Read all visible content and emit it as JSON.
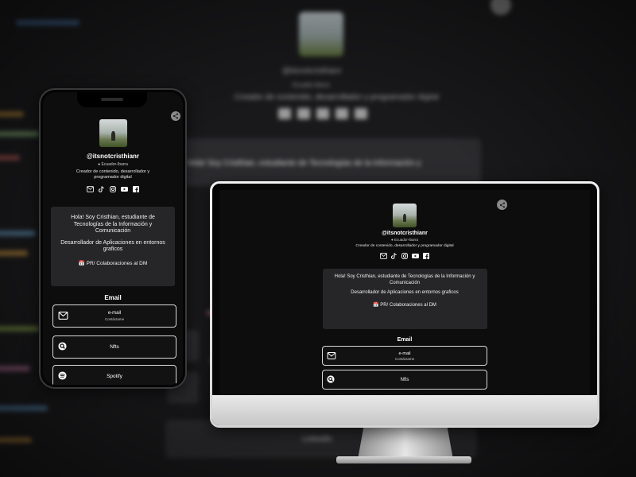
{
  "profile": {
    "handle": "@itsnotcristhianr",
    "location": "Ecuador-Ibarra",
    "bio": "Creador de contenido, desarrollador y programador digital",
    "intro_greeting": "Hola! Soy Cristhian, estudiante de Tecnologías de la Información y Comunicación",
    "intro_dev": "Desarrollador de Aplicaciones en entornos graficos",
    "intro_collab": "PR/ Colaboraciones al DM",
    "collab_emoji": "📅",
    "social_icons": [
      "email-icon",
      "tiktok-icon",
      "instagram-icon",
      "youtube-icon",
      "facebook-icon"
    ]
  },
  "sections": {
    "email_title": "Email"
  },
  "links": {
    "email": {
      "label": "e-mail",
      "sublabel": "Contáctame",
      "icon": "mail-icon"
    },
    "nfts": {
      "label": "Nfts",
      "icon": "opensea-icon"
    },
    "spotify": {
      "label": "Spotify",
      "icon": "spotify-icon"
    }
  },
  "icons": {
    "share": "share-icon",
    "location": "pin-icon"
  },
  "colors": {
    "page_background": "#0d0d0e",
    "intro_card": "#262629",
    "button_border": "#d9d9d9",
    "share_button": "#8a8a8a"
  }
}
